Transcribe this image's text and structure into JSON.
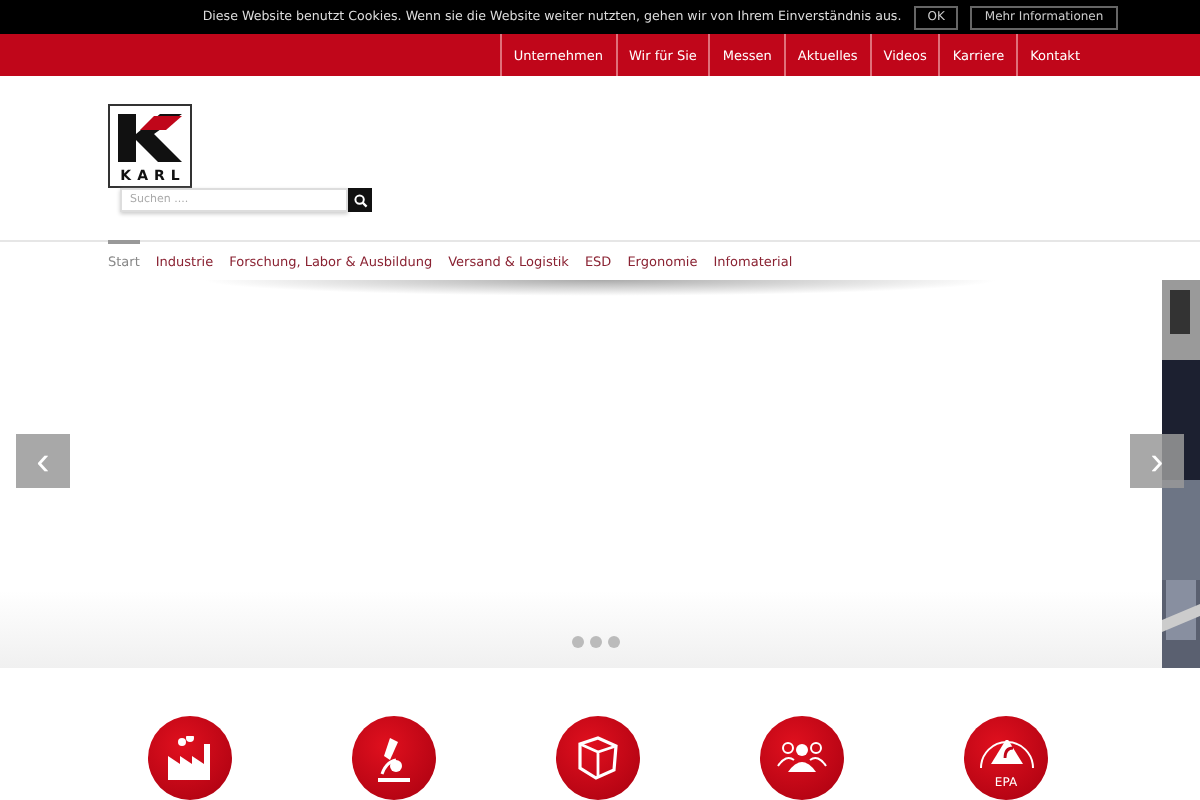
{
  "cookie_bar": {
    "message": "Diese Website benutzt Cookies. Wenn sie die Website weiter nutzten, gehen wir von Ihrem Einverständnis aus.",
    "buttons": [
      "OK",
      "Mehr Informationen"
    ]
  },
  "top_nav": [
    "Unternehmen",
    "Wir für Sie",
    "Messen",
    "Aktuelles",
    "Videos",
    "Karriere",
    "Kontakt"
  ],
  "logo": {
    "text": "KARL"
  },
  "search": {
    "placeholder": "Suchen ...."
  },
  "main_nav": [
    {
      "label": "Start",
      "selected": true
    },
    {
      "label": "Industrie",
      "selected": false
    },
    {
      "label": "Forschung, Labor & Ausbildung",
      "selected": false
    },
    {
      "label": "Versand & Logistik",
      "selected": false
    },
    {
      "label": "ESD",
      "selected": false
    },
    {
      "label": "Ergonomie",
      "selected": false
    },
    {
      "label": "Infomaterial",
      "selected": false
    }
  ],
  "slider": {
    "arrows": [
      "‹",
      "›"
    ],
    "dots": [
      {
        "selected": false
      },
      {
        "selected": false
      },
      {
        "selected": false
      }
    ]
  },
  "categories": [
    {
      "kind": "factory"
    },
    {
      "kind": "microscope"
    },
    {
      "kind": "box"
    },
    {
      "kind": "people"
    },
    {
      "kind": "esd",
      "label": "EPA"
    }
  ]
}
